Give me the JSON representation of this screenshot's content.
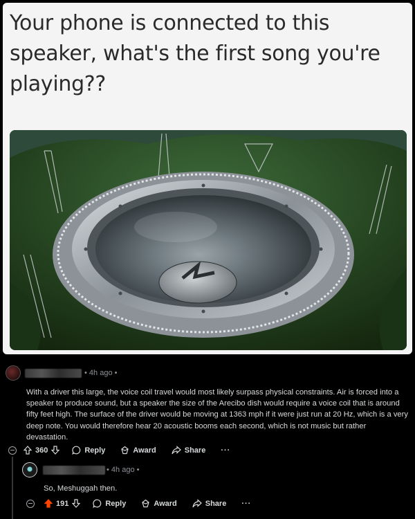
{
  "meme": {
    "caption": "Your phone is connected  to this speaker, what's the first song you're playing??"
  },
  "comments": [
    {
      "time": "4h ago",
      "text": "With a driver this large, the voice coil travel would most likely surpass physical constraints. Air is forced into a speaker to produce sound, but a speaker the size of the Arecibo dish would require a voice coil that is around fifty feet high. The surface of the driver would be moving at 1363 mph if it were just run at 20 Hz, which is a very deep note. You would therefore hear 20 acoustic booms each second, which is not music but rather devastation.",
      "score": "360",
      "actions": {
        "reply": "Reply",
        "award": "Award",
        "share": "Share",
        "more": "···"
      }
    },
    {
      "time": "4h ago",
      "text": "So, Meshuggah then.",
      "score": "191",
      "actions": {
        "reply": "Reply",
        "award": "Award",
        "share": "Share",
        "more": "···"
      }
    }
  ],
  "colors": {
    "background": "#000000",
    "text": "#d7dadc",
    "meta": "#8e9296",
    "upvote_active": "#ff4500"
  }
}
